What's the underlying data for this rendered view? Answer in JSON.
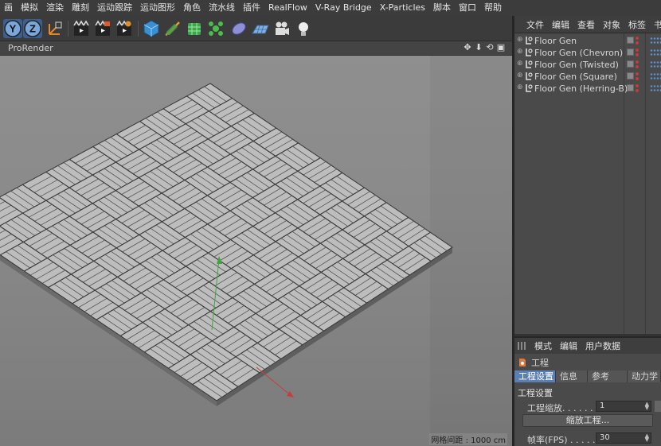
{
  "menu": [
    "画",
    "模拟",
    "渲染",
    "雕刻",
    "运动跟踪",
    "运动图形",
    "角色",
    "流水线",
    "插件",
    "RealFlow",
    "V-Ray Bridge",
    "X-Particles",
    "脚本",
    "窗口",
    "帮助"
  ],
  "toolbar": {
    "icons": [
      "y-axis-lock-icon",
      "z-axis-lock-icon",
      "coordinate-system-icon",
      "render-view-icon",
      "render-picture-viewer-icon",
      "render-settings-icon",
      "cube-icon",
      "pen-spline-icon",
      "subdivision-icon",
      "cloner-icon",
      "deformer-icon",
      "floor-icon",
      "camera-icon",
      "light-icon"
    ],
    "y_label": "Y",
    "z_label": "Z"
  },
  "viewport": {
    "title": "ProRender",
    "nav_icons": [
      "✥",
      "⬇",
      "⟲",
      "▣"
    ],
    "grid_label": "网格间距 : 1000 cm",
    "scene_colors": {
      "floor_top": "#bdbdbd",
      "floor_side": "#5e5e5e",
      "y_axis": "#3fa53f",
      "x_axis": "#c83c3c"
    }
  },
  "object_manager": {
    "menu": [
      "文件",
      "编辑",
      "查看",
      "对象",
      "标签",
      "书"
    ],
    "objects": [
      "Floor Gen",
      "Floor Gen (Chevron)",
      "Floor Gen (Twisted)",
      "Floor Gen (Square)",
      "Floor Gen (Herring-B)"
    ]
  },
  "attribute_manager": {
    "menu": [
      "模式",
      "编辑",
      "用户数据"
    ],
    "title": "工程",
    "tabs": [
      "工程设置",
      "信息",
      "参考",
      "动力学"
    ],
    "active_tab": 0,
    "section": "工程设置",
    "scale_label": "工程缩放. . . . . . . . .",
    "scale_value": "1",
    "scale_button": "缩放工程...",
    "fps_label": "帧率(FPS) . . . . . . .",
    "fps_value": "30"
  }
}
